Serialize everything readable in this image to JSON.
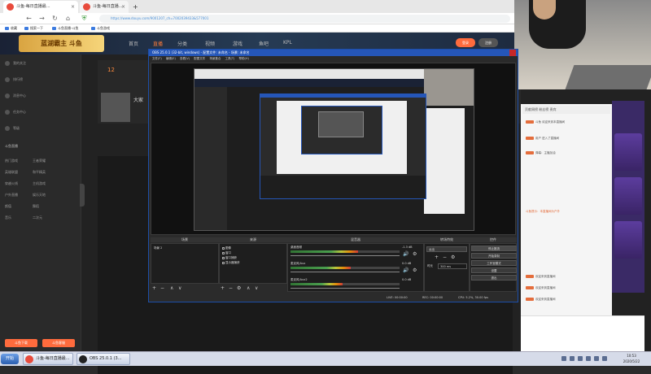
{
  "browser": {
    "tabs": [
      {
        "label": "斗鱼-每日直播最..."
      },
      {
        "label": "斗鱼-每日直播..."
      }
    ],
    "nav": {
      "back": "←",
      "forward": "→",
      "reload": "↻",
      "home": "⌂",
      "shield": "⛨"
    },
    "url": "https://www.douyu.com/9001207_ch=7002039433&577001",
    "bookmarks": [
      "收藏",
      "搜索一下",
      "斗鱼直播-斗鱼",
      "斗鱼游戏"
    ]
  },
  "site": {
    "logo": "蓝湖霸主 斗鱼",
    "nav": [
      "首页",
      "直播",
      "分类",
      "视频",
      "游戏",
      "鱼吧",
      "KPL"
    ],
    "header_buttons": [
      "登录",
      "注册"
    ],
    "sidebar": {
      "items": [
        "我的关注",
        "排行榜",
        "消息中心",
        "任务中心",
        "等级",
        "斗鱼直播",
        "热门游戏",
        "王者荣耀",
        "英雄联盟",
        "和平精英",
        "穿越火线",
        "主机游戏",
        "户外直播",
        "娱乐天地",
        "颜值",
        "舞蹈",
        "音乐",
        "二次元"
      ],
      "buttons": [
        "斗鱼下载",
        "斗鱼客服"
      ]
    },
    "room": {
      "count": "12",
      "streamer": "大家"
    },
    "chat": {
      "title": "贡献周榜 粉丝榜 贵宾",
      "messages": [
        "斗鱼 欢迎来到本直播间",
        "用户 进入了直播间",
        "弹幕：主播加油",
        "斗鱼提示：本直播间为户外",
        "欢迎来到直播间",
        "欢迎来到直播间",
        "欢迎来到直播间"
      ]
    }
  },
  "obs": {
    "title": "OBS 25.0.1 (32-bit, windows) - 配置文件: 未命名 - 场景: 未命名",
    "menu": [
      "文件(F)",
      "编辑(E)",
      "查看(V)",
      "配置文件",
      "场景集合",
      "工具(T)",
      "帮助(H)"
    ],
    "docks": {
      "scenes": {
        "header": "场景",
        "items": [
          "场景 2"
        ]
      },
      "sources": {
        "header": "来源",
        "items": [
          "图像",
          "窗口",
          "窗口捕获",
          "显示器捕获"
        ]
      },
      "mixer": {
        "header": "混音器",
        "channels": [
          {
            "name": "桌面音频",
            "db": "-1.3 dB",
            "level": 0.62
          },
          {
            "name": "麦克风/Aux",
            "db": "0.0 dB",
            "level": 0.55
          },
          {
            "name": "麦克风/Aux2",
            "db": "0.0 dB",
            "level": 0.48
          }
        ]
      },
      "transitions": {
        "header": "转场特效",
        "mode": "淡出",
        "duration_label": "时长",
        "duration": "300 ms"
      },
      "controls": {
        "header": "控件",
        "buttons": [
          "停止推流",
          "开始录制",
          "工作室模式",
          "设置",
          "退出"
        ]
      }
    },
    "status": {
      "live": "LIVE: 00:00:00",
      "rec": "REC: 00:00:00",
      "cpu": "CPU: 5.2%, 30.00 fps"
    }
  },
  "taskbar": {
    "start": "开始",
    "tasks": [
      {
        "label": "斗鱼-每日直播最..."
      },
      {
        "label": "OBS 25.0.1 (3..."
      }
    ],
    "clock": {
      "time": "10:53",
      "date": "2020/5/22"
    }
  }
}
